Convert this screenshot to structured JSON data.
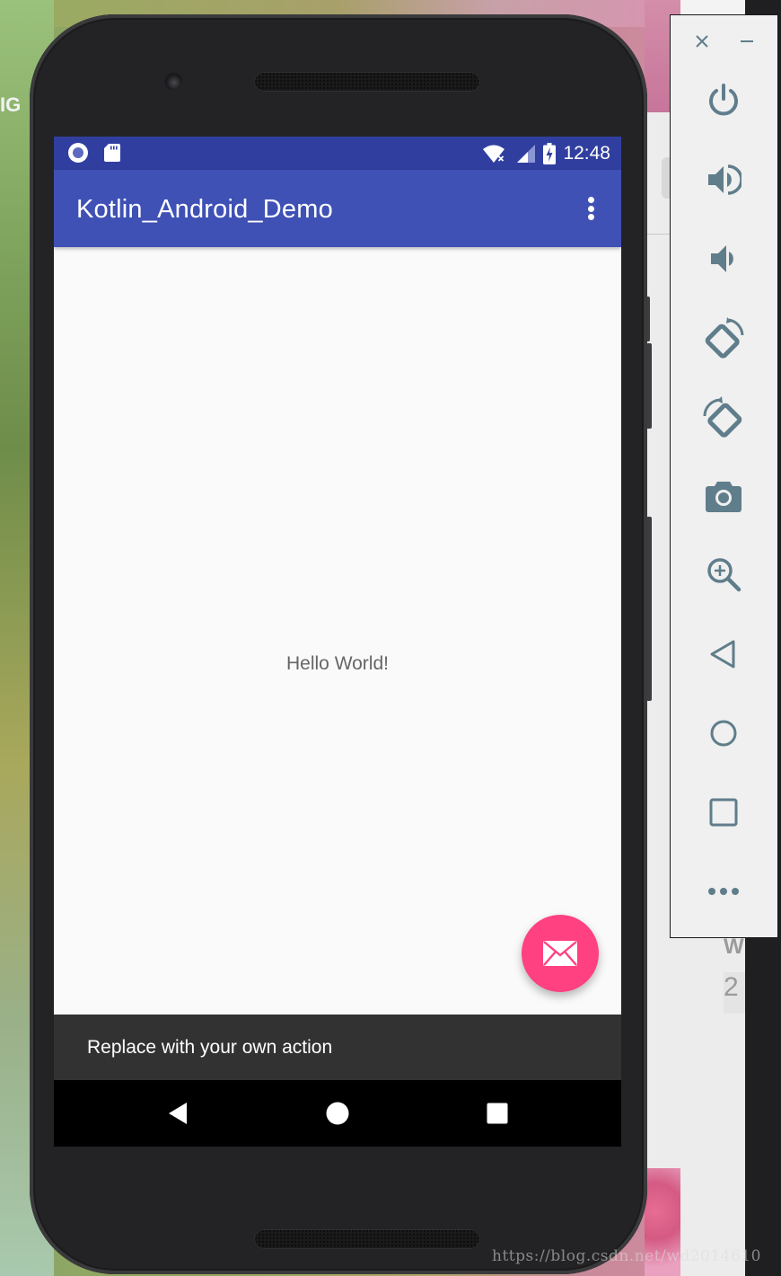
{
  "background": {
    "left_fragment_text": "IG",
    "side_fragment_letter": "W",
    "side_fragment_number": "2",
    "watermark": "https://blog.csdn.net/wd2014610"
  },
  "device": {
    "status_bar": {
      "time": "12:48",
      "left_icons": [
        "sync-circle-icon",
        "sd-card-icon"
      ],
      "right_icons": [
        "wifi-no-internet-icon",
        "cell-signal-icon",
        "battery-charging-icon"
      ]
    },
    "app_bar": {
      "title": "Kotlin_Android_Demo",
      "overflow_icon": "more-vert-icon"
    },
    "content": {
      "message": "Hello World!"
    },
    "fab": {
      "icon": "email-icon",
      "color": "#ff4081"
    },
    "snackbar": {
      "text": "Replace with your own action"
    },
    "nav_bar": {
      "buttons": [
        "back",
        "home",
        "recents"
      ]
    },
    "colors": {
      "primary": "#3f51b5",
      "primary_dark": "#303f9f",
      "accent": "#ff4081",
      "snackbar": "#323232",
      "screen_bg": "#fafafa"
    }
  },
  "emulator_toolbar": {
    "window_controls": [
      "close",
      "minimize"
    ],
    "tools": [
      {
        "name": "power",
        "tooltip": "Power"
      },
      {
        "name": "volume-up",
        "tooltip": "Volume up"
      },
      {
        "name": "volume-down",
        "tooltip": "Volume down"
      },
      {
        "name": "rotate-left",
        "tooltip": "Rotate left"
      },
      {
        "name": "rotate-right",
        "tooltip": "Rotate right"
      },
      {
        "name": "screenshot",
        "tooltip": "Take screenshot"
      },
      {
        "name": "zoom",
        "tooltip": "Zoom mode"
      },
      {
        "name": "back",
        "tooltip": "Back"
      },
      {
        "name": "home",
        "tooltip": "Home"
      },
      {
        "name": "overview",
        "tooltip": "Overview"
      },
      {
        "name": "more",
        "tooltip": "Extended controls"
      }
    ],
    "icon_color": "#607d8b"
  }
}
